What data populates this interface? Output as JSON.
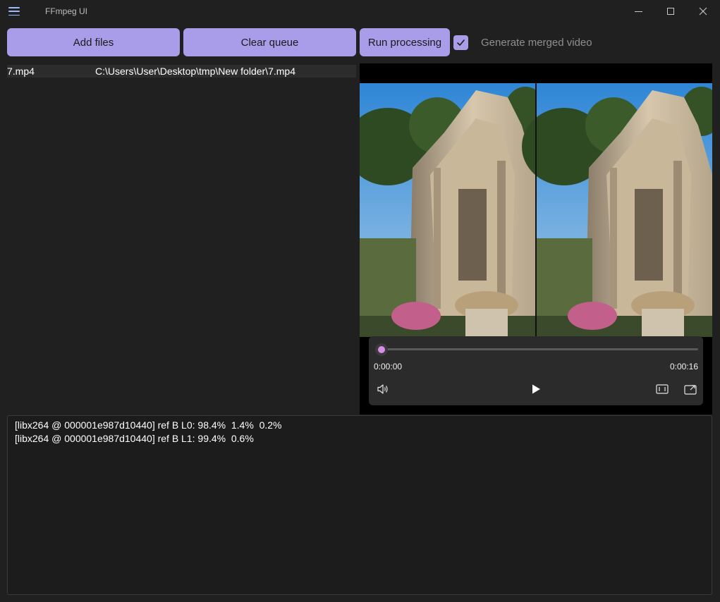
{
  "window": {
    "title": "FFmpeg UI",
    "icons": {
      "menu": "hamburger-menu-icon",
      "minimize": "minimize-icon",
      "maximize": "maximize-icon",
      "close": "close-icon"
    }
  },
  "toolbar": {
    "add_files_label": "Add files",
    "clear_queue_label": "Clear queue",
    "run_processing_label": "Run processing",
    "merged_video_checked": true,
    "merged_video_label": "Generate merged video"
  },
  "queue": {
    "items": [
      {
        "name": "7.mp4",
        "path": "C:\\Users\\User\\Desktop\\tmp\\New folder\\7.mp4"
      }
    ]
  },
  "player": {
    "current_time": "0:00:00",
    "duration": "0:00:16",
    "progress_fraction": 0.0,
    "icons": {
      "volume": "volume-icon",
      "play": "play-icon",
      "aspect": "aspect-ratio-icon",
      "pip": "mini-player-icon"
    }
  },
  "log": {
    "lines": [
      "[libx264 @ 000001e987d10440] ref B L0: 98.4%  1.4%  0.2%",
      "[libx264 @ 000001e987d10440] ref B L1: 99.4%  0.6%"
    ]
  },
  "colors": {
    "accent": "#a99ce8",
    "seek_fill": "#cf7be0",
    "background": "#202020"
  }
}
